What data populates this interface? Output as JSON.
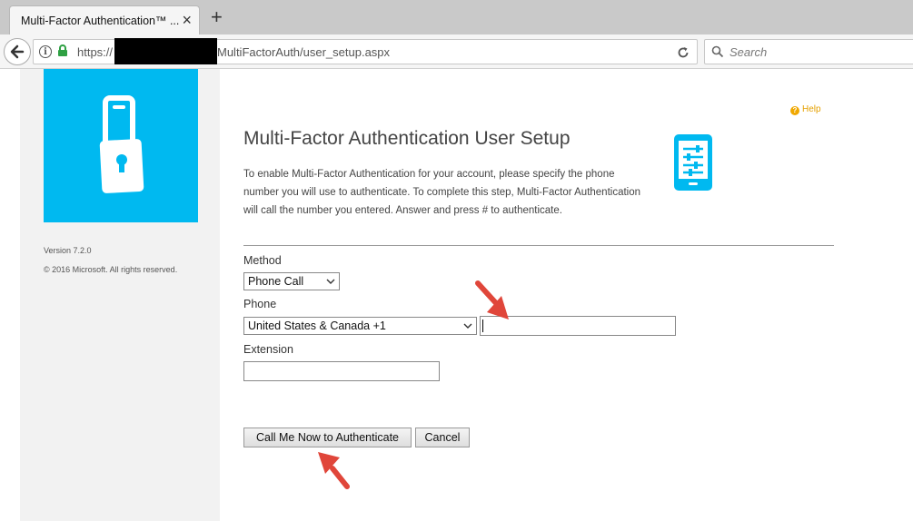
{
  "browser": {
    "tab_title": "Multi-Factor Authentication™ ...",
    "tab_close": "×",
    "new_tab": "+",
    "url_prefix": "https://",
    "url_path": "MultiFactorAuth/user_setup.aspx",
    "search_placeholder": "Search"
  },
  "sidebar": {
    "version": "Version 7.2.0",
    "copyright": "© 2016 Microsoft. All rights reserved."
  },
  "main": {
    "help_label": "Help",
    "title": "Multi-Factor Authentication User Setup",
    "description": "To enable Multi-Factor Authentication for your account, please specify the phone number you will use to authenticate. To complete this step, Multi-Factor Authentication will call the number you entered. Answer and press # to authenticate.",
    "method_label": "Method",
    "method_value": "Phone Call",
    "phone_label": "Phone",
    "country_value": "United States & Canada +1",
    "phone_number_value": "",
    "extension_label": "Extension",
    "extension_value": "",
    "call_button": "Call Me Now to Authenticate",
    "cancel_button": "Cancel"
  },
  "colors": {
    "logo_tile": "#00b9f0",
    "annotation_arrow": "#e0463a",
    "help": "#e5a000"
  },
  "icons": [
    "back-arrow-icon",
    "info-icon",
    "lock-icon",
    "reload-icon",
    "search-icon",
    "padlock-phone-icon",
    "help-icon",
    "settings-phone-icon",
    "chevron-down-icon",
    "annotation-arrow-icon"
  ]
}
